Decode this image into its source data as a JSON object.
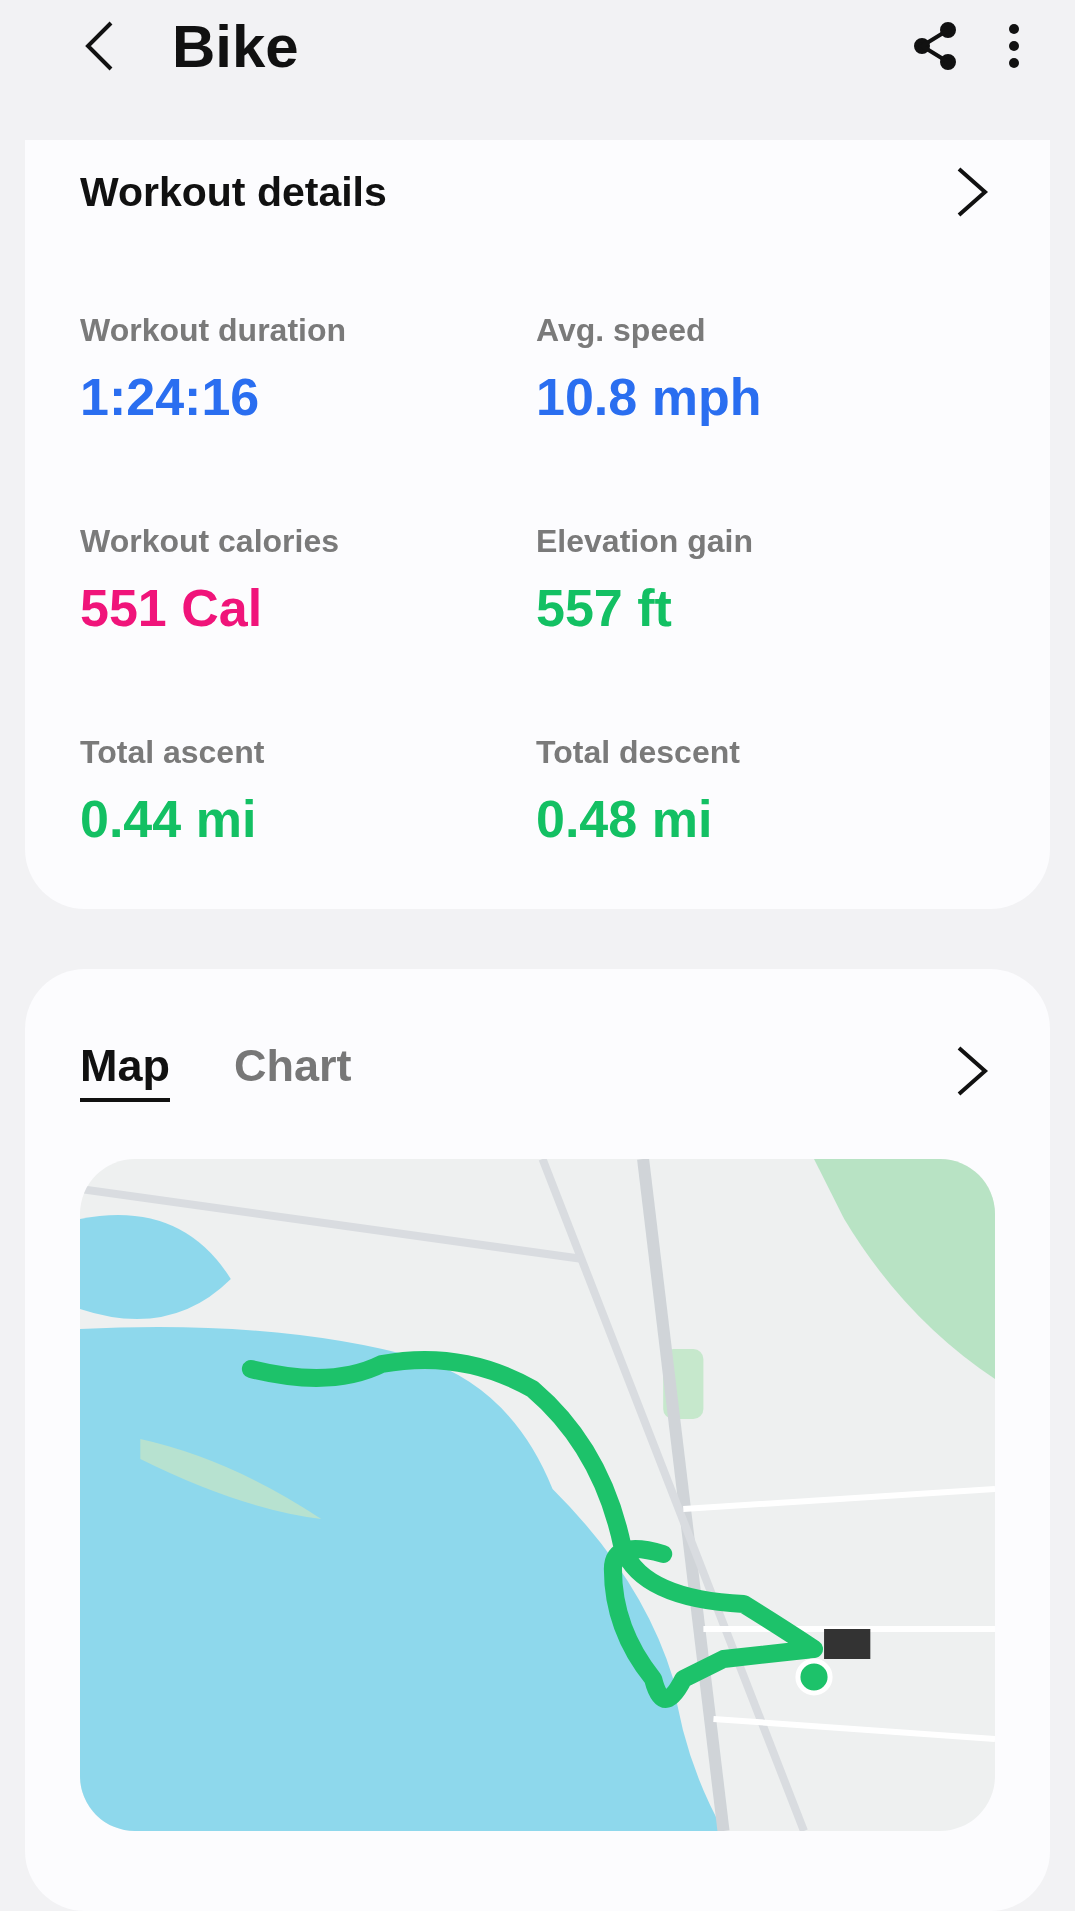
{
  "header": {
    "title": "Bike"
  },
  "details": {
    "title": "Workout details",
    "stats": [
      {
        "label": "Workout duration",
        "value": "1:24:16",
        "color": "#2a6ef0"
      },
      {
        "label": "Avg. speed",
        "value": "10.8 mph",
        "color": "#2a6ef0"
      },
      {
        "label": "Workout calories",
        "value": "551 Cal",
        "color": "#f0147a"
      },
      {
        "label": "Elevation gain",
        "value": "557 ft",
        "color": "#13c063"
      },
      {
        "label": "Total ascent",
        "value": "0.44 mi",
        "color": "#13c063"
      },
      {
        "label": "Total descent",
        "value": "0.48 mi",
        "color": "#13c063"
      }
    ]
  },
  "map_card": {
    "tabs": [
      {
        "label": "Map",
        "selected": true
      },
      {
        "label": "Chart",
        "selected": false
      }
    ]
  }
}
